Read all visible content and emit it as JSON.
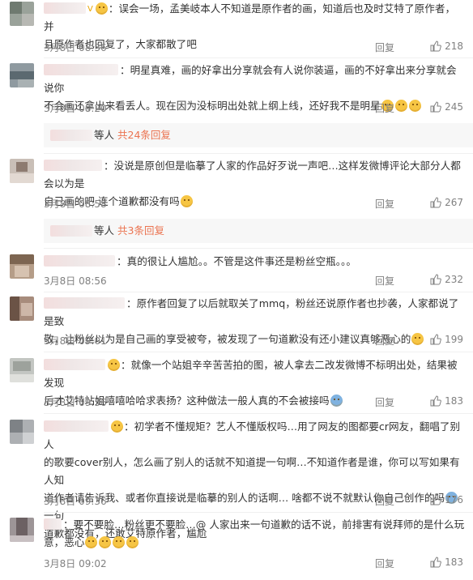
{
  "comments": [
    {
      "id": "c1",
      "line1": "：误会一场，孟美岐本人不知道是原作者的画，知道后也及时艾特了原作者，并",
      "line2": "且原作者也回复了，大家都散了吧",
      "time": "3月8日 08:36",
      "reply": "回复",
      "likes": "218"
    },
    {
      "id": "c2",
      "line1": "：明星真难，画的好拿出分享就会有人说你装逼，画的不好拿出来分享就会说你",
      "line2": "不会画还拿出来看丢人。现在因为没标明出处就上纲上线，还好我不是明星",
      "time": "3月8日 08:20",
      "reply": "回复",
      "likes": "245"
    },
    {
      "id": "c3",
      "line1": "：没说是原创但是临摹了人家的作品好歹说一声吧…这样发微博评论大部分人都会以为是",
      "line2": "自己画的吧 连个道歉都没有吗",
      "time": "3月8日 08:58",
      "reply": "回复",
      "likes": "267"
    },
    {
      "id": "c4",
      "line1": "：真的很让人尴尬。。不管是这件事还是粉丝空瓶。。。",
      "time": "3月8日 08:56",
      "reply": "回复",
      "likes": "232"
    },
    {
      "id": "c5",
      "line1": "：原作者回复了以后就取关了mmq，粉丝还说原作者也抄袭，人家都说了是致",
      "line2": "敬，让粉丝以为是自己画的享受被夸，被发现了一句道歉没有还小建议真够恶心的",
      "time": "3月8日 09:01",
      "reply": "回复",
      "likes": "199"
    },
    {
      "id": "c6",
      "line1": "：就像一个站姐辛辛苦苦拍的图，被人拿去二改发微博不标明出处，结果被发现",
      "line2": "后才艾特站姐嘻嘻哈哈求表扬？这种做法一般人真的不会被接吗",
      "time": "3月8日 09:36",
      "reply": "回复",
      "likes": "183"
    },
    {
      "id": "c7",
      "line1": "：初学者不懂规矩？艺人不懂版权吗…用了网友的图都要cr网友，翻唱了别人",
      "line2": "的歌要cover别人，怎么画了别人的话就不知道提一句啊…不知道作者是谁，你可以写如果有人知",
      "line3": "道作者请告诉我、或者你直接说是临摹的别人的话啊… 啥都不说不就默认你自己创作的吗",
      "line3b": "一句",
      "line4": "道歉都没有，还敢艾特原作者，尴尬",
      "time": "3月8日 09:36",
      "reply": "回复",
      "likes": "176"
    },
    {
      "id": "c8",
      "line1": "：要不要脸…粉丝更不要脸…@ 人家出来一句道歉的话不说，前排害有说拜师的是什么玩",
      "line2": "意，恶心",
      "time": "3月8日 09:02",
      "reply": "回复",
      "likes": "183"
    }
  ],
  "sub_replies": [
    {
      "prefix": "等人",
      "more": "共24条回复"
    },
    {
      "prefix": "等人",
      "more": "共3条回复"
    }
  ],
  "colors": {
    "accent": "#eb7350",
    "meta_gray": "#808080",
    "badge_gold": "#e8a300"
  }
}
